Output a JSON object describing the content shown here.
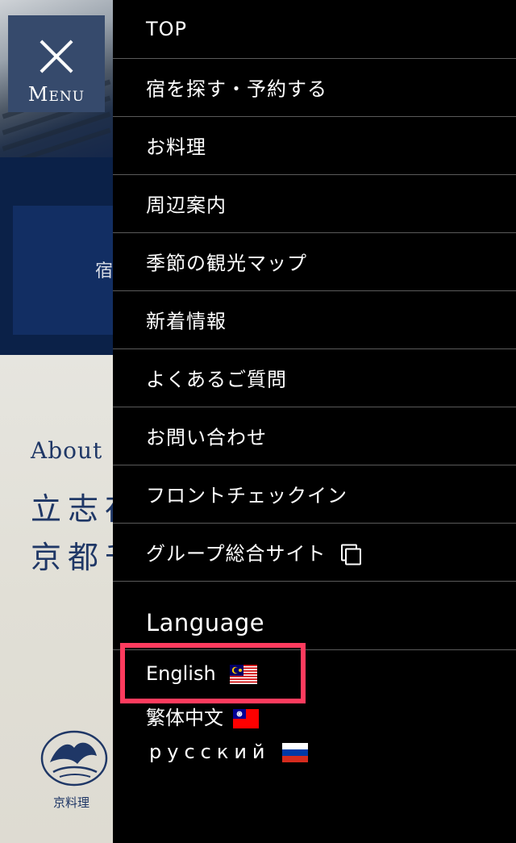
{
  "menu_button": {
    "label": "Menu"
  },
  "background": {
    "hero_text": "宿",
    "about_heading": "About",
    "about_title_line1": "立志存",
    "about_title_line2": "京都千",
    "logo_caption": "京料理"
  },
  "nav": {
    "items": [
      {
        "label": "TOP"
      },
      {
        "label": "宿を探す・予約する"
      },
      {
        "label": "お料理"
      },
      {
        "label": "周辺案内"
      },
      {
        "label": "季節の観光マップ"
      },
      {
        "label": "新着情報"
      },
      {
        "label": "よくあるご質問"
      },
      {
        "label": "お問い合わせ"
      },
      {
        "label": "フロントチェックイン"
      },
      {
        "label": "グループ総合サイト",
        "icon": "external-link-icon"
      }
    ]
  },
  "language": {
    "heading": "Language",
    "options": [
      {
        "label": "English",
        "flag": "malaysia-flag-icon"
      },
      {
        "label": "繁体中文",
        "flag": "taiwan-flag-icon"
      },
      {
        "label": "русский",
        "flag": "russia-flag-icon"
      }
    ]
  },
  "colors": {
    "drawer_bg": "#000000",
    "menu_button_bg": "#364a6c",
    "navy": "#0b2148",
    "highlight": "#ff3b5e"
  }
}
